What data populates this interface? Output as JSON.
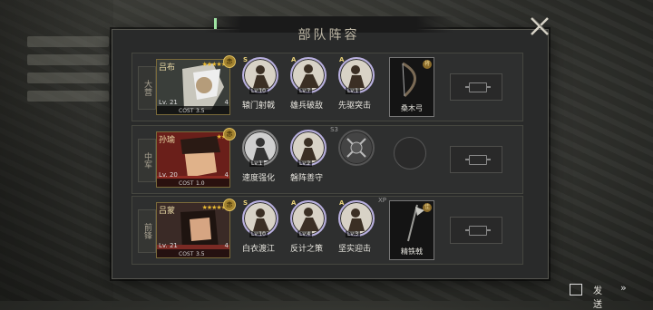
{
  "title": "部队阵容",
  "rows": [
    {
      "label": "大营",
      "hero": {
        "name": "吕布",
        "stars": "★★★★★",
        "level": "Lv. 21",
        "cost_label": "COST",
        "cost": "3.5",
        "badge": "4",
        "seal": "赤"
      },
      "skills": [
        {
          "name": "辕门射戟",
          "lv": "Lv.10",
          "grade": "S",
          "style": "lilac"
        },
        {
          "name": "雄兵破敌",
          "lv": "Lv.7",
          "grade": "A",
          "style": "lilac"
        },
        {
          "name": "先驱突击",
          "lv": "Lv.1",
          "grade": "A",
          "style": "lilac"
        }
      ],
      "equip": {
        "name": "桑木弓",
        "mark": "将"
      }
    },
    {
      "label": "中军",
      "hero": {
        "name": "孙瑜",
        "stars": "★★",
        "level": "Lv. 20",
        "cost_label": "COST",
        "cost": "1.0",
        "badge": "4",
        "seal": "赤"
      },
      "skills": [
        {
          "name": "速度强化",
          "lv": "Lv.1",
          "grade": "",
          "style": "grey"
        },
        {
          "name": "磐阵善守",
          "lv": "Lv.2",
          "grade": "",
          "style": "lilac",
          "tag": "S3"
        },
        {
          "name": "",
          "lv": "",
          "grade": "",
          "style": "empty"
        }
      ],
      "equip": null
    },
    {
      "label": "前锋",
      "hero": {
        "name": "吕蒙",
        "stars": "★★★★★",
        "level": "Lv. 21",
        "cost_label": "COST",
        "cost": "3.5",
        "badge": "4",
        "seal": "赤"
      },
      "skills": [
        {
          "name": "白衣渡江",
          "lv": "Lv.10",
          "grade": "S",
          "style": "lilac"
        },
        {
          "name": "反计之策",
          "lv": "Lv.4",
          "grade": "A",
          "style": "lilac"
        },
        {
          "name": "坚实迎击",
          "lv": "Lv.3",
          "grade": "A",
          "style": "lilac",
          "tag": "XP"
        }
      ],
      "equip": {
        "name": "精铁戟",
        "mark": "佳"
      }
    }
  ],
  "send": {
    "label": "发送",
    "arrow": "»"
  },
  "colors": {
    "accent_gold": "#e8b932",
    "lilac_ring": "#b9b0e0",
    "panel_bg": "#292a2a"
  },
  "icons": {
    "close": "close-x-icon",
    "send": "share-icon"
  }
}
